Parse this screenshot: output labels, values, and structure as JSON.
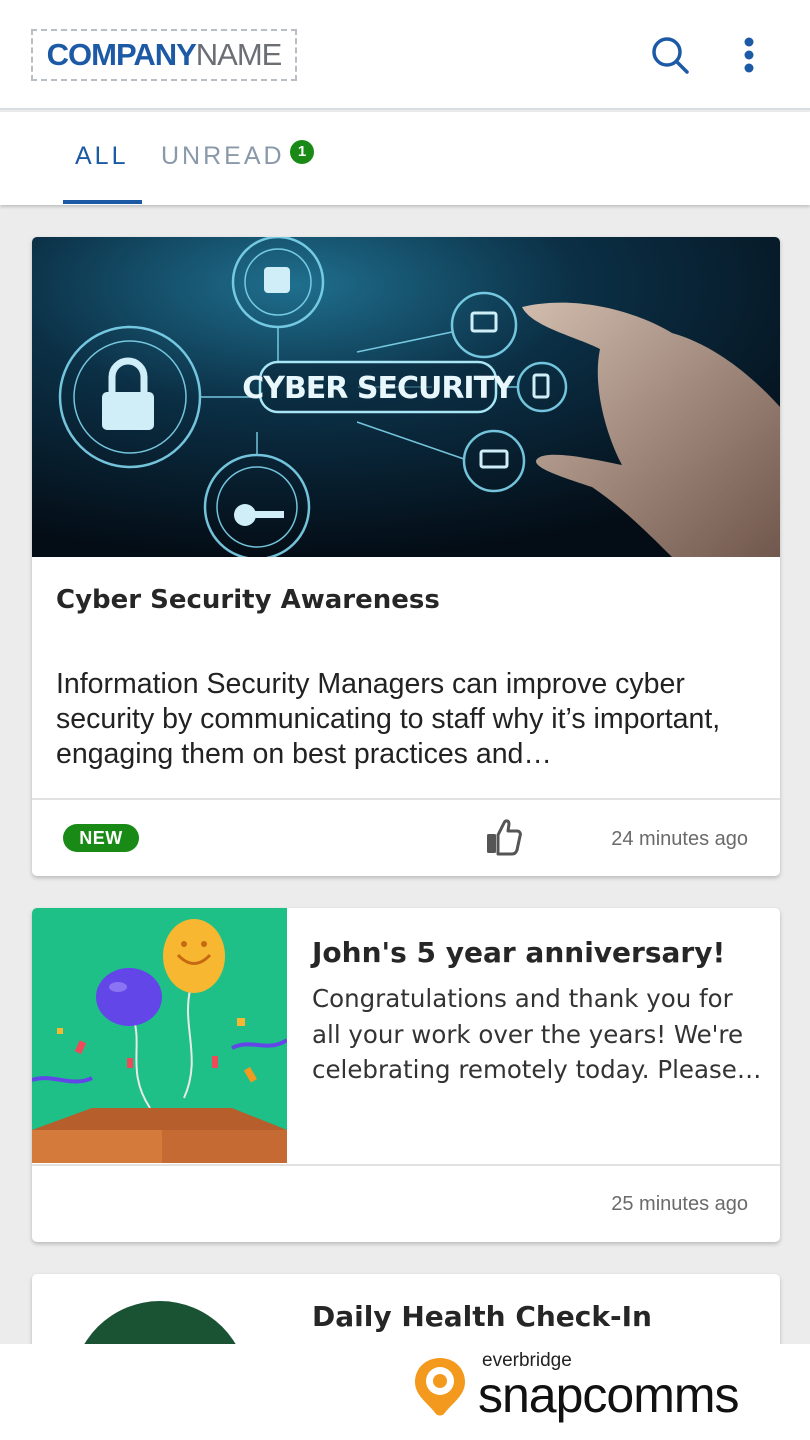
{
  "header": {
    "logo_company": "COMPANY",
    "logo_name": "NAME"
  },
  "tabs": {
    "all_label": "ALL",
    "unread_label": "UNREAD",
    "unread_count": "1",
    "active": "ALL"
  },
  "feed": [
    {
      "image_text": "CYBER SECURITY",
      "title": "Cyber Security Awareness",
      "body": "Information Security Managers can improve cyber security by communicating to staff why it’s important, engaging them on best practices and…",
      "badge": "NEW",
      "timestamp": "24 minutes ago"
    },
    {
      "title": "John's 5 year anniversary!",
      "body": "Congratulations and thank you for all your work over the years! We're celebrating remotely today. Please…",
      "timestamp": "25 minutes ago"
    },
    {
      "title": "Daily Health Check-In"
    }
  ],
  "footer": {
    "brand_small": "everbridge",
    "brand_large": "snapcomms"
  },
  "colors": {
    "primary": "#1d5aa6",
    "badge_green": "#1a8a16",
    "tab_inactive": "#8a99aa",
    "background": "#ececec",
    "brand_orange": "#f39a1e"
  }
}
